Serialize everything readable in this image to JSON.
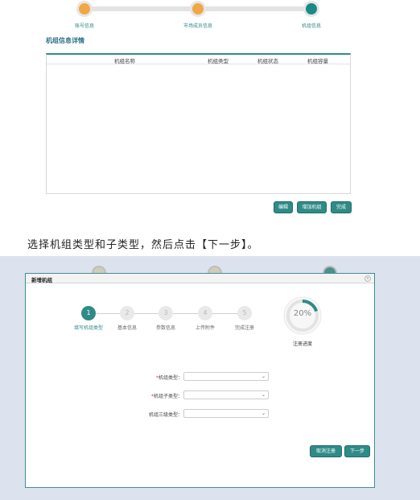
{
  "top_panel": {
    "steps": [
      {
        "label": "账号信息",
        "state": "done"
      },
      {
        "label": "市场成员信息",
        "state": "done"
      },
      {
        "label": "机组信息",
        "state": "current"
      }
    ],
    "section_title": "机组信息详情",
    "table_headers": [
      "机组名称",
      "机组类型",
      "机组状态",
      "机组容量"
    ],
    "buttons": {
      "edit": "编辑",
      "add_unit": "增加机组",
      "finish": "完成"
    }
  },
  "instruction": "选择机组类型和子类型，然后点击【下一步】。",
  "dialog": {
    "title": "新增机组",
    "close_icon": "close-icon",
    "wizard_steps": [
      {
        "num": "1",
        "label": "填写机组类型",
        "active": true
      },
      {
        "num": "2",
        "label": "基本信息",
        "active": false
      },
      {
        "num": "3",
        "label": "参数信息",
        "active": false
      },
      {
        "num": "4",
        "label": "上传附件",
        "active": false
      },
      {
        "num": "5",
        "label": "完成注册",
        "active": false
      }
    ],
    "progress": {
      "value_text": "20%",
      "percent": 20,
      "label": "注册进度"
    },
    "fields": [
      {
        "required": true,
        "label": "机组类型：",
        "value": ""
      },
      {
        "required": true,
        "label": "机组子类型：",
        "value": ""
      },
      {
        "required": false,
        "label": "机组三级类型：",
        "value": ""
      }
    ],
    "buttons": {
      "cancel": "取消注册",
      "next": "下一步"
    }
  },
  "colors": {
    "accent": "#2f8b87",
    "done_step": "#f0a844",
    "required": "#d9312b"
  }
}
